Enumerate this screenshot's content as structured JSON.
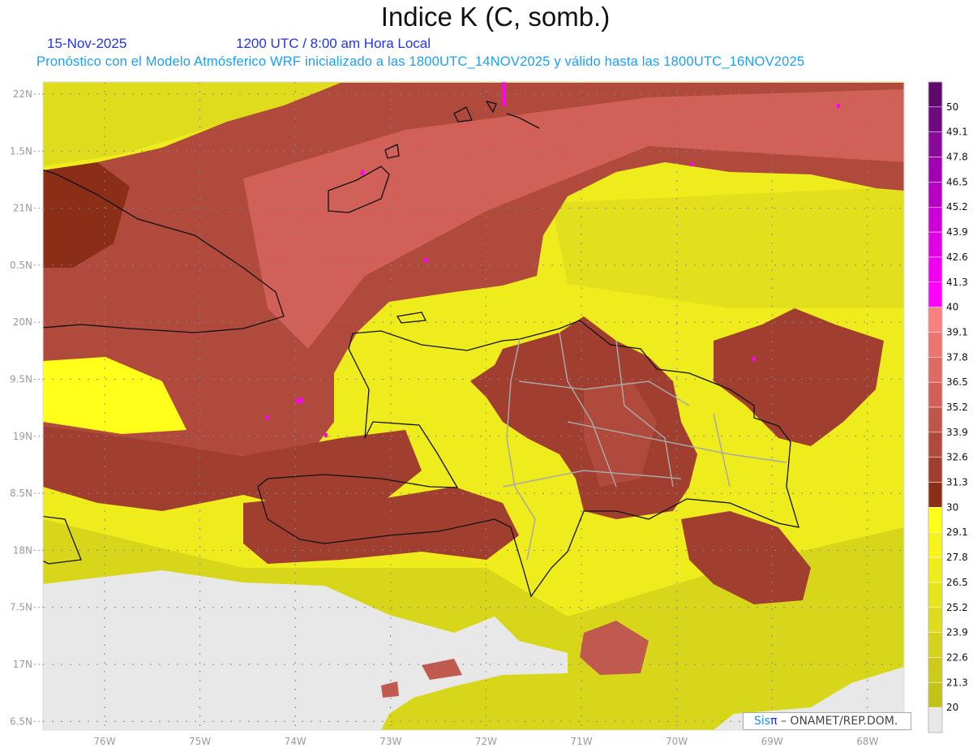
{
  "header": {
    "title": "Indice K (C, somb.)",
    "date": "15-Nov-2025",
    "time": "1200 UTC / 8:00 am Hora Local",
    "subtitle": "Pronóstico con el Modelo Atmósferico WRF inicializado a las 1800UTC_14NOV2025 y válido hasta las  1800UTC_16NOV2025"
  },
  "axes": {
    "lat_labels": [
      "22N",
      "1.5N",
      "21N",
      "0.5N",
      "20N",
      "9.5N",
      "19N",
      "8.5N",
      "18N",
      "7.5N",
      "17N",
      "6.5N"
    ],
    "lon_labels": [
      "76W",
      "75W",
      "74W",
      "73W",
      "72W",
      "71W",
      "70W",
      "69W",
      "68W"
    ]
  },
  "colorbar": {
    "labels": [
      "50",
      "49.1",
      "47.8",
      "46.5",
      "45.2",
      "43.9",
      "42.6",
      "41.3",
      "40",
      "39.1",
      "37.8",
      "36.5",
      "35.2",
      "33.9",
      "32.6",
      "31.3",
      "30",
      "29.1",
      "27.8",
      "26.5",
      "25.2",
      "23.9",
      "22.6",
      "21.3",
      "20"
    ],
    "colors": [
      "#5e0a6c",
      "#6e0a80",
      "#880a98",
      "#a000b0",
      "#b800c4",
      "#cc00d4",
      "#e000e4",
      "#f000f0",
      "#ff00ff",
      "#f88080",
      "#ec7570",
      "#de6a62",
      "#d06058",
      "#bf5548",
      "#b04a3c",
      "#a03e30",
      "#8a2e18",
      "#ffff1a",
      "#f6f41c",
      "#eeec1c",
      "#e6e41c",
      "#dedc1c",
      "#d4d21a",
      "#cccb1a",
      "#c2c218",
      "#e8e8e8"
    ]
  },
  "credit": {
    "brand_sis": "Sis",
    "brand_pi": "π",
    "text": "– ONAMET/REP.DOM."
  }
}
